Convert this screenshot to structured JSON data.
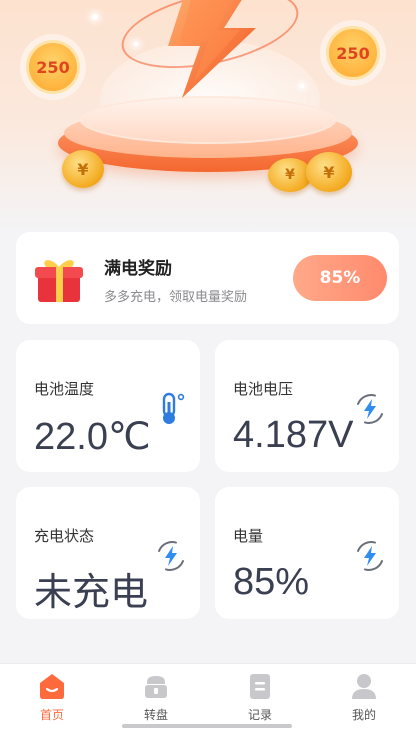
{
  "hero": {
    "badge_left": "250",
    "badge_right": "250",
    "coin_symbol": "¥",
    "colors": {
      "accent": "#f4672f",
      "gold": "#ffa62b"
    }
  },
  "reward": {
    "title": "满电奖励",
    "subtitle": "多多充电，领取电量奖励",
    "button": "85%",
    "icon": "gift-icon"
  },
  "stats": [
    {
      "label": "电池温度",
      "value": "22.0℃",
      "icon": "thermometer-icon"
    },
    {
      "label": "电池电压",
      "value": "4.187V",
      "icon": "charging-bolt-icon"
    },
    {
      "label": "充电状态",
      "value": "未充电",
      "icon": "charging-bolt-icon"
    },
    {
      "label": "电量",
      "value": "85%",
      "icon": "charging-bolt-icon"
    }
  ],
  "nav": {
    "items": [
      {
        "label": "首页",
        "icon": "home-icon",
        "active": true
      },
      {
        "label": "转盘",
        "icon": "wheel-icon",
        "active": false
      },
      {
        "label": "记录",
        "icon": "record-icon",
        "active": false
      },
      {
        "label": "我的",
        "icon": "user-icon",
        "active": false
      }
    ],
    "active_color": "#ff6a3c"
  }
}
